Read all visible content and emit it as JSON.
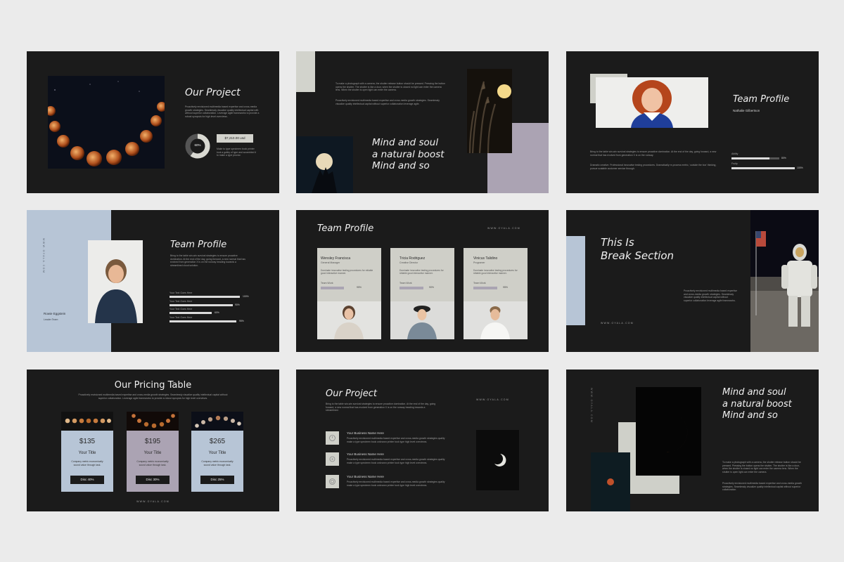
{
  "colors": {
    "page_bg": "#ebebeb",
    "slide_bg": "#1b1b1b",
    "sage": "#cfd0c9",
    "lavender": "#aba3b3",
    "blue_gray": "#b7c5d6"
  },
  "slide1": {
    "title": "Our Project",
    "body": "Proactively envisioned multimedia based expertise and cross-media growth strategies. Seamlessly visualize quality intellectual capital with without superior collaboration. Leverage agile frameworks to provide a robust synopsis for high level overviews.",
    "donut_label": "60%",
    "donut_percent": 60,
    "price": "$7,210.00 usd",
    "price_note": "Make to type specimen book printer took a galley of type and scrambled it to make a type proctor."
  },
  "slide2": {
    "body1": "To make a photograph with a camera, the shutter release button should be pressed. Pressing the button opens the shutter. The shutter is like a door, when the shutter is closed no light can enter the camera lens. When the shutter is open light can enter the camera.",
    "body2": "Proactively envisioned multimedia based expertise and cross-media growth strategies. Seamlessly visualize quality intellectual capital without superior collaboration leverage agile.",
    "headline_line1": "Mind and soul",
    "headline_line2": "a natural boost",
    "headline_line3": "Mind and so"
  },
  "slide3": {
    "title": "Team Profile",
    "name": "Nathalie Gilbertson",
    "body1": "Bring to the table win-win survival strategies to ensure proactive domination. At the end of the day, going forward, a new normal that has evolved from generation X is on the runway.",
    "body2": "Dramatic creative. Professional innovative testing procedures. Dramatically re-process metric, 'outside the box' thinking, pursue scalable customer service through.",
    "skills": [
      {
        "label": "Ability",
        "value": 80,
        "display": "80%"
      },
      {
        "label": "Fruity",
        "value": 100,
        "display": "100%"
      }
    ]
  },
  "slide4": {
    "vertical": "WWW.OYALA.COM",
    "title": "Team Profile",
    "body": "Bring to the table win-win survival strategies to ensure proactive domination. At the end of the day, going forward, a new normal that has evolved from generation X is on the runway heading towards a streamlined cloud solution.",
    "person_name": "Rowie Eggstein",
    "person_role": "Leader Team",
    "bars": [
      {
        "label": "Your Text Goes Here",
        "value": 100,
        "display": "100%"
      },
      {
        "label": "Your Text Goes Here",
        "value": 90,
        "display": "90%"
      },
      {
        "label": "Your Text Goes Here",
        "value": 60,
        "display": "60%"
      },
      {
        "label": "Your Text Goes Here",
        "value": 95,
        "display": "95%"
      }
    ]
  },
  "slide5": {
    "title": "Team Profile",
    "url": "WWW.OYALA.COM",
    "members": [
      {
        "name": "Wensley Francisca",
        "role": "General Manager",
        "desc": "Dominate innovative testing procedures for reliable good interactive manner.",
        "team": "Team Work",
        "value": 95,
        "display": "95%"
      },
      {
        "name": "Tricia Rodriguez",
        "role": "Creative Director",
        "desc": "Dominate innovative testing procedures for reliable good interactive manner.",
        "team": "Team Work",
        "value": 90,
        "display": "90%"
      },
      {
        "name": "Vinicus Talidino",
        "role": "Programer",
        "desc": "Dominate innovative testing procedures for reliable good interactive manner.",
        "team": "Team Work",
        "value": 95,
        "display": "95%"
      }
    ]
  },
  "slide6": {
    "title_line1": "This Is",
    "title_line2": "Break Section",
    "body": "Proactively envisioned multimedia based expertise and cross-media growth strategies. Seamlessly visualize quality intellectual capital without superior collaboration leverage agile frameworks.",
    "url": "WWW.OYALA.COM"
  },
  "slide7": {
    "title": "Our Pricing Table",
    "subtitle": "Proactively envisioned multimedia based expertise and cross-media growth strategies. Seamlessly visualize quality intellectual capital without superior collaboration. Leverage agile frameworks to provide a robust synopsis for high level overviews.",
    "url": "WWW.OYALA.COM",
    "plans": [
      {
        "price": "$135",
        "title": "Your Title",
        "desc": "Company metric economically sound value through task.",
        "button": "Disc 40%"
      },
      {
        "price": "$195",
        "title": "Your Title",
        "desc": "Company metric economically sound value through task.",
        "button": "Disc 30%"
      },
      {
        "price": "$265",
        "title": "Your Title",
        "desc": "Company metric economically sound value through task.",
        "button": "Disc 25%"
      }
    ]
  },
  "slide8": {
    "title": "Our Project",
    "url": "WWW.OYALA.COM",
    "body": "Bring to the table win-win survival strategies to ensure proactive domination. At the end of the day, going forward, a new normal that has evolved from generation X is on the runway heading towards a streamlined.",
    "items": [
      {
        "name": "Your Business Name Here",
        "desc": "Proactively envisioned multimedia based expertise and cross-media growth strategies quality make a type specimen book unknown printer took type high level overviews."
      },
      {
        "name": "Your Business Name Here",
        "desc": "Proactively envisioned multimedia based expertise and cross-media growth strategies quality make a type specimen book unknown printer took type high level overviews."
      },
      {
        "name": "Your Business Name Here",
        "desc": "Proactively envisioned multimedia based expertise and cross-media growth strategies quality make a type specimen book unknown printer took type high level overviews."
      }
    ]
  },
  "slide9": {
    "vertical": "WWW.OYALA.COM",
    "headline_line1": "Mind and soul",
    "headline_line2": "a natural boost",
    "headline_line3": "Mind and so",
    "body1": "To make a photograph with a camera, the shutter release button should be pressed. Pressing the button opens the shutter. The shutter is like a door, when the shutter is closed no light can enter the camera lens. When the shutter is open light can enter the camera.",
    "body2": "Proactively envisioned multimedia based expertise and cross-media growth strategies. Seamlessly visualize quality intellectual capital without superior collaboration."
  }
}
